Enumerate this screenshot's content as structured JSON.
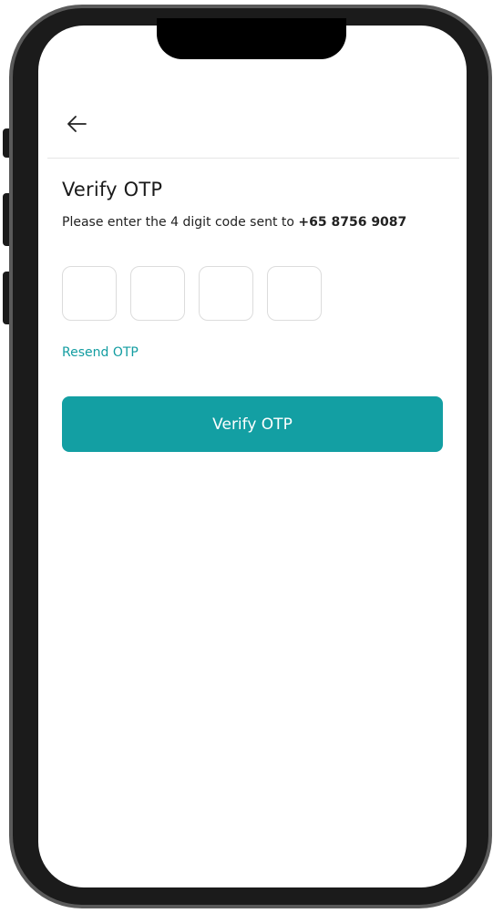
{
  "header": {
    "back_icon": "arrow-left-icon"
  },
  "page": {
    "title": "Verify OTP",
    "subtitle_prefix": "Please enter the 4 digit code sent to ",
    "phone_number": "+65 8756 9087"
  },
  "otp": {
    "digits": [
      "",
      "",
      "",
      ""
    ]
  },
  "actions": {
    "resend_label": "Resend OTP",
    "verify_label": "Verify OTP"
  },
  "colors": {
    "accent": "#139fa3",
    "link": "#139da1"
  }
}
